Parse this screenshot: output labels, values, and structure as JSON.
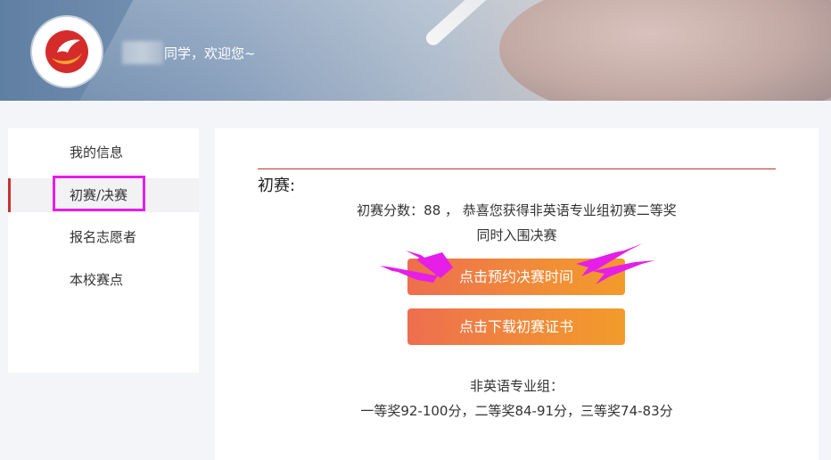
{
  "header": {
    "welcome_text": "同学，欢迎您~"
  },
  "sidebar": {
    "items": [
      {
        "label": "我的信息"
      },
      {
        "label": "初赛/决赛"
      },
      {
        "label": "报名志愿者"
      },
      {
        "label": "本校赛点"
      }
    ]
  },
  "main": {
    "section_title": "初赛:",
    "score_line": "初赛分数：88 ， 恭喜您获得非英语专业组初赛二等奖",
    "status_line": "同时入围决赛",
    "buttons": {
      "book_final": "点击预约决赛时间",
      "download_cert": "点击下载初赛证书"
    },
    "group_title": "非英语专业组：",
    "award_ranges": "一等奖92-100分，二等奖84-91分，三等奖74-83分"
  },
  "colors": {
    "accent_red": "#c8332b",
    "button_gradient_start": "#ee6e4f",
    "button_gradient_end": "#f39b2a",
    "annotation_magenta": "#e51ee8"
  }
}
